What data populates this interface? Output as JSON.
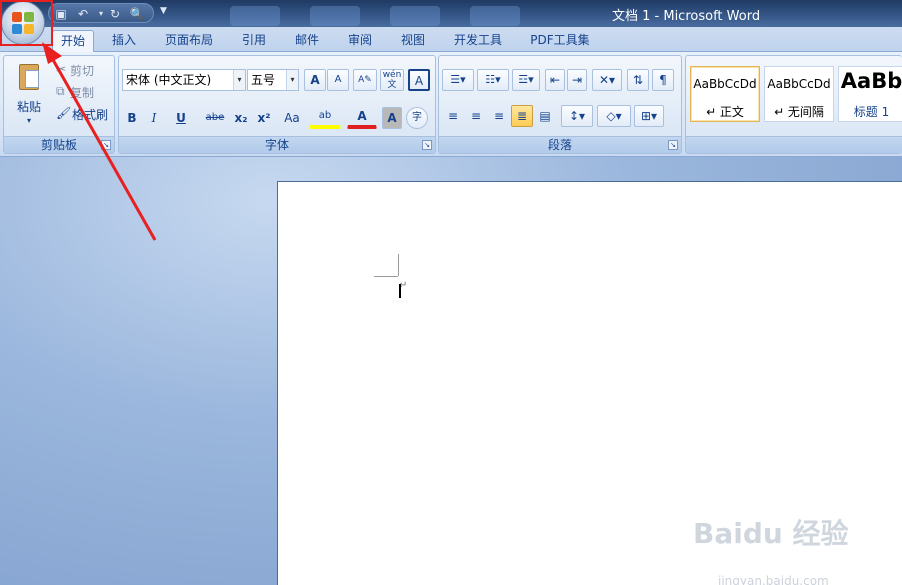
{
  "window": {
    "title": "文档 1 - Microsoft Word"
  },
  "qat": {
    "save_icon": "save-icon",
    "undo_icon": "undo-icon",
    "redo_icon": "redo-icon",
    "preview_icon": "print-preview-icon"
  },
  "tabs": [
    {
      "label": "开始",
      "active": true
    },
    {
      "label": "插入"
    },
    {
      "label": "页面布局"
    },
    {
      "label": "引用"
    },
    {
      "label": "邮件"
    },
    {
      "label": "审阅"
    },
    {
      "label": "视图"
    },
    {
      "label": "开发工具"
    },
    {
      "label": "PDF工具集"
    }
  ],
  "clipboard": {
    "paste_label": "粘贴",
    "cut_label": "剪切",
    "copy_label": "复制",
    "format_painter_label": "格式刷",
    "group_label": "剪贴板"
  },
  "font": {
    "font_name": "宋体 (中文正文)",
    "font_size": "五号",
    "group_label": "字体",
    "bold": "B",
    "italic": "I",
    "underline": "U",
    "strike": "abe",
    "subscript": "x₂",
    "superscript": "x²",
    "change_case": "Aa",
    "grow": "A",
    "shrink": "A",
    "phonetic": "wén",
    "phonetic_char": "文",
    "char_border": "A",
    "highlight": "ab",
    "font_color": "A",
    "char_shading": "A",
    "enclose": "字"
  },
  "paragraph": {
    "group_label": "段落"
  },
  "styles": [
    {
      "sample": "AaBbCcDd",
      "name": "↵ 正文",
      "selected": true
    },
    {
      "sample": "AaBbCcDd",
      "name": "↵ 无间隔"
    },
    {
      "sample": "AaBb",
      "name": "标题 1"
    }
  ],
  "watermark": {
    "text": "Baidu 经验",
    "sub": "jingyan.baidu.com"
  },
  "colors": {
    "annotation": "#e82020",
    "ribbon_text": "#15428b"
  }
}
